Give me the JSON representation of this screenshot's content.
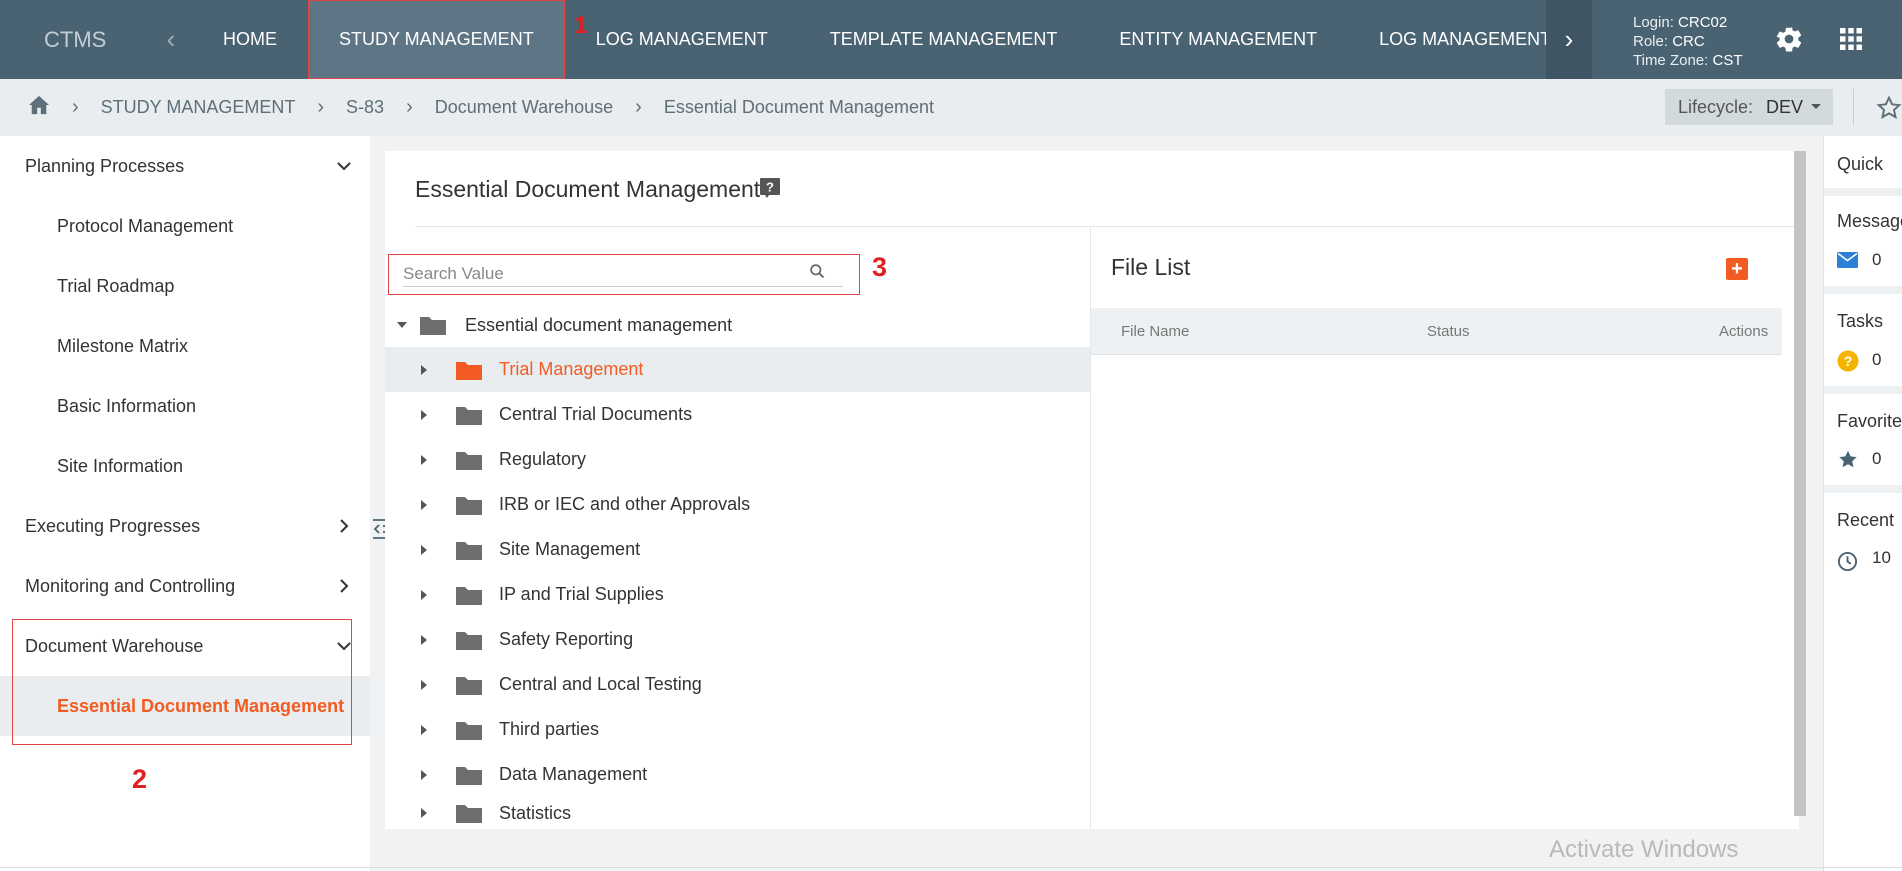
{
  "topnav": {
    "brand": "CTMS",
    "items": [
      "HOME",
      "STUDY MANAGEMENT",
      "LOG MANAGEMENT",
      "TEMPLATE MANAGEMENT",
      "ENTITY MANAGEMENT",
      "LOG MANAGEMENT"
    ],
    "user": {
      "login_label": "Login:",
      "login": "CRC02",
      "role_label": "Role:",
      "role": "CRC",
      "tz_label": "Time Zone:",
      "tz": "CST"
    }
  },
  "breadcrumb": {
    "items": [
      "STUDY MANAGEMENT",
      "S-83",
      "Document Warehouse",
      "Essential Document Management"
    ],
    "lifecycle_label": "Lifecycle:",
    "lifecycle_value": "DEV"
  },
  "sidebar": {
    "groups": [
      {
        "label": "Planning Processes"
      },
      {
        "label": "Protocol Management"
      },
      {
        "label": "Trial Roadmap"
      },
      {
        "label": "Milestone Matrix"
      },
      {
        "label": "Basic Information"
      },
      {
        "label": "Site Information"
      },
      {
        "label": "Executing Progresses"
      },
      {
        "label": "Monitoring and Controlling"
      },
      {
        "label": "Document Warehouse"
      },
      {
        "label": "Essential Document Management"
      }
    ]
  },
  "main": {
    "title": "Essential Document Management",
    "search_placeholder": "Search Value",
    "tree_root": "Essential document management",
    "tree_items": [
      "Trial Management",
      "Central Trial Documents",
      "Regulatory",
      "IRB or IEC and other Approvals",
      "Site Management",
      "IP and Trial Supplies",
      "Safety Reporting",
      "Central and Local Testing",
      "Third parties",
      "Data Management",
      "Statistics"
    ],
    "file_list": {
      "title": "File List",
      "columns": [
        "File Name",
        "Status",
        "Actions"
      ]
    }
  },
  "quick": {
    "title": "Quick",
    "messages_label": "Messages",
    "messages_count": "0",
    "tasks_label": "Tasks",
    "tasks_count": "0",
    "favorites_label": "Favorites",
    "favorites_count": "0",
    "recent_label": "Recent",
    "recent_count": "10"
  },
  "annotations": [
    "1",
    "2",
    "3"
  ],
  "watermark": "Activate Windows",
  "colors": {
    "nav_bg": "#4a6372",
    "accent": "#f25c22",
    "annotation": "#e24545"
  }
}
